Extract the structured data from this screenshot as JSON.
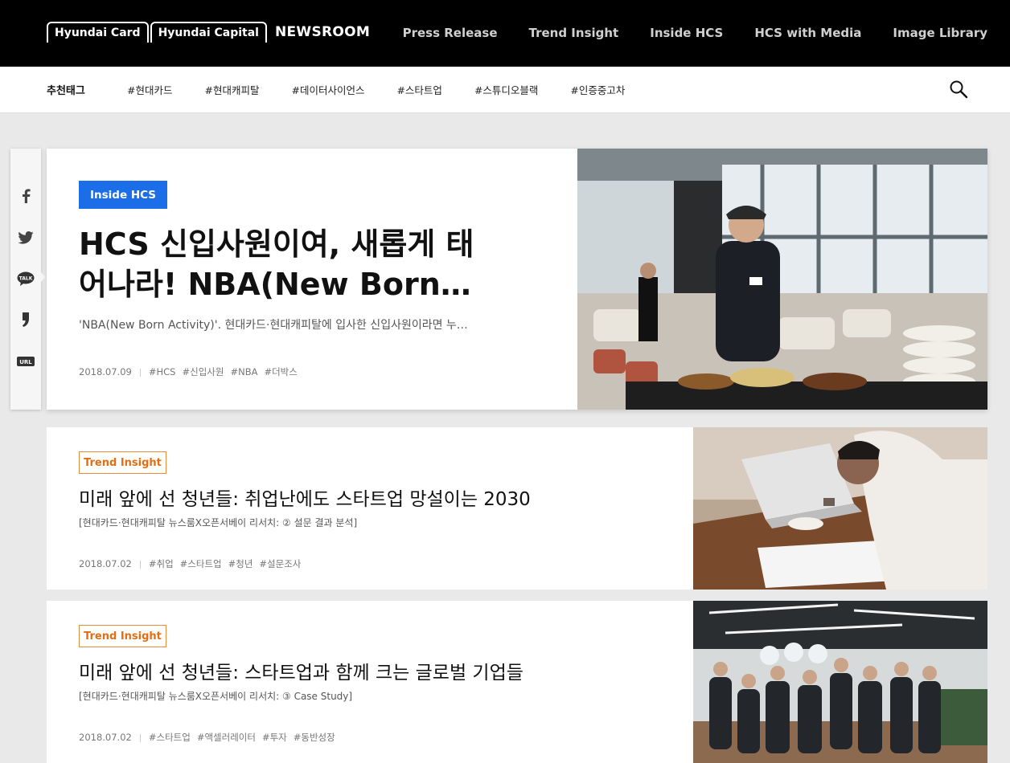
{
  "header": {
    "logo": {
      "card": "Hyundai Card",
      "capital": "Hyundai Capital",
      "newsroom": "NEWSROOM"
    },
    "nav": [
      "Press Release",
      "Trend Insight",
      "Inside HCS",
      "HCS with Media",
      "Image Library"
    ]
  },
  "tagbar": {
    "title": "추천태그",
    "tags": [
      "#현대카드",
      "#현대캐피탈",
      "#데이터사이언스",
      "#스타트업",
      "#스튜디오블랙",
      "#인증중고차"
    ]
  },
  "share": {
    "talk": "TALK",
    "url": "URL"
  },
  "featured": {
    "category": "Inside HCS",
    "title": "HCS 신입사원이여, 새롭게 태어나라! NBA(New Born…",
    "title_line1": "HCS 신입사원이여, 새롭게 태",
    "title_line2": "어나라! NBA(New Born…",
    "description": "'NBA(New Born Activity)'. 현대카드·현대캐피탈에 입사한 신입사원이라면 누…",
    "date": "2018.07.09",
    "tags": [
      "#HCS",
      "#신입사원",
      "#NBA",
      "#더박스"
    ]
  },
  "articles": [
    {
      "category": "Trend Insight",
      "title": "미래 앞에 선 청년들: 취업난에도 스타트업 망설이는 2030",
      "subtitle": "[현대카드·현대캐피탈 뉴스룸X오픈서베이 리서치: ② 설문 결과 분석]",
      "date": "2018.07.02",
      "tags": [
        "#취업",
        "#스타트업",
        "#청년",
        "#설문조사"
      ]
    },
    {
      "category": "Trend Insight",
      "title": "미래 앞에 선 청년들: 스타트업과 함께 크는 글로벌 기업들",
      "subtitle": "[현대카드·현대캐피탈 뉴스룸X오픈서베이 리서치: ③ Case Study]",
      "date": "2018.07.02",
      "tags": [
        "#스타트업",
        "#액셀러레이터",
        "#투자",
        "#동반성장"
      ]
    }
  ],
  "colors": {
    "accent_blue": "#1b6ee8",
    "accent_orange": "#e26e16",
    "header_bg": "#000000"
  }
}
